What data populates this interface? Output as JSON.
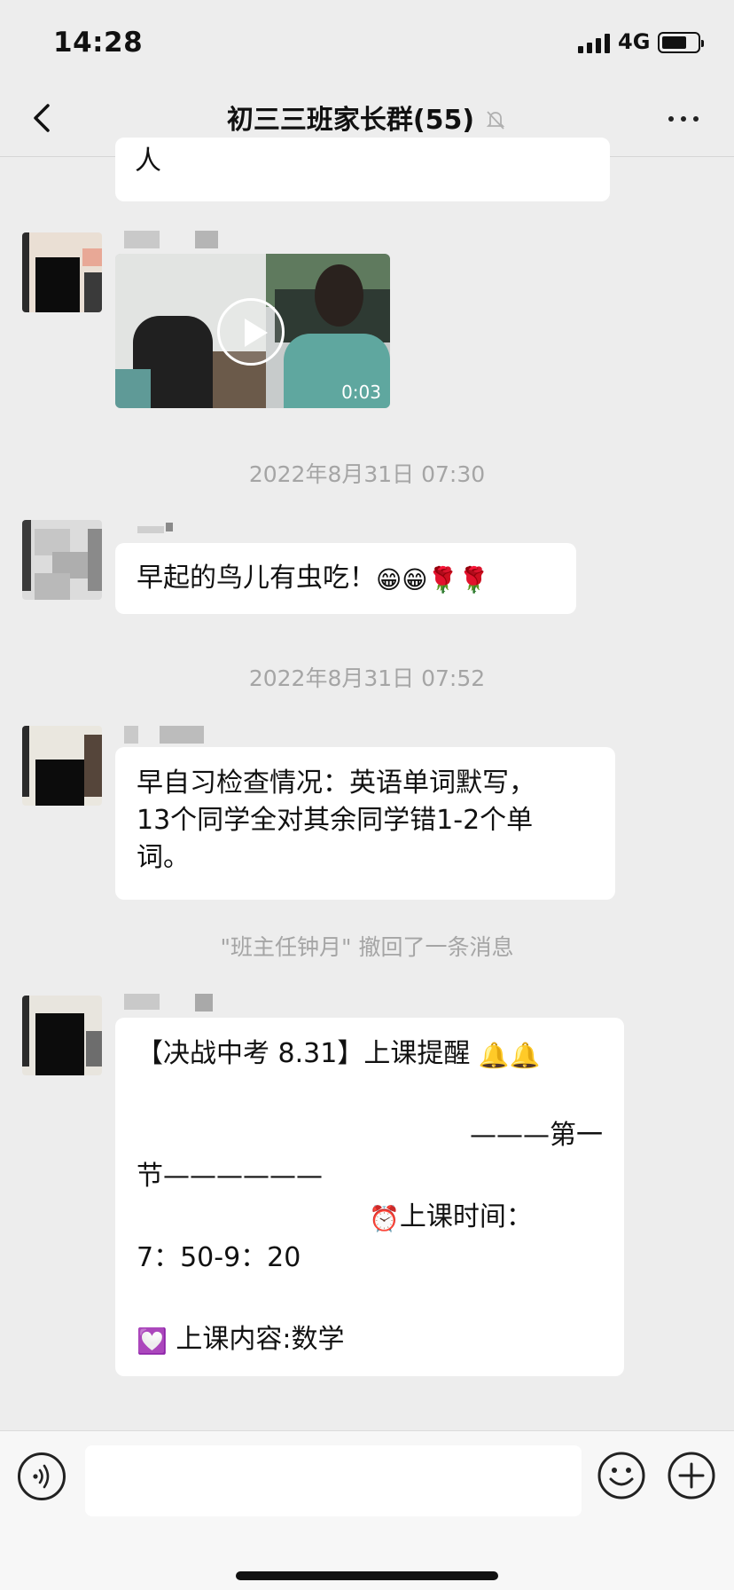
{
  "status_bar": {
    "time": "14:28",
    "network": "4G"
  },
  "nav": {
    "title": "初三三班家长群(55)"
  },
  "messages": {
    "prev_bubble_text": "人",
    "video_duration": "0:03",
    "timestamp_1": "2022年8月31日 07:30",
    "msg2_text": "早起的鸟儿有虫吃！",
    "msg2_emojis": [
      "😁",
      "😁",
      "🌹",
      "🌹"
    ],
    "timestamp_2": "2022年8月31日 07:52",
    "msg3_lines": [
      "早自习检查情况：英语单词默写，",
      "13个同学全对其余同学错1-2个单",
      "词。"
    ],
    "system_notice": "\"班主任钟月\" 撤回了一条消息",
    "msg4": {
      "line1": "【决战中考 8.31】上课提醒",
      "line1_emojis": "🔔🔔",
      "line2": "———第一",
      "line3": "节——————",
      "line4_emoji": "⏰",
      "line4": "上课时间：",
      "line5": "7：50-9：20",
      "line6_emoji": "💟",
      "line6": "上课内容:数学"
    }
  },
  "input": {
    "placeholder": ""
  }
}
